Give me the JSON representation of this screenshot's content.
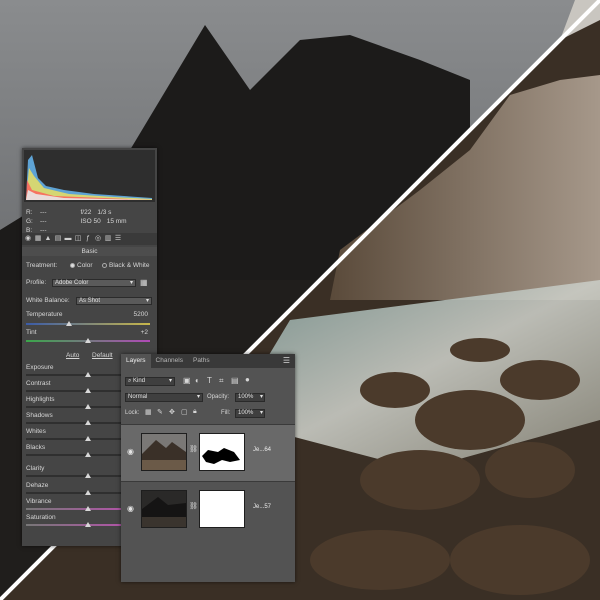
{
  "acr": {
    "readout": {
      "r": "R:",
      "g": "G:",
      "b": "B:",
      "dashes": "---",
      "aperture": "f/22",
      "shutter": "1/3 s",
      "iso": "ISO 50",
      "focal": "15 mm"
    },
    "section_title": "Basic",
    "treatment_label": "Treatment:",
    "treatment_color": "Color",
    "treatment_bw": "Black & White",
    "profile_label": "Profile:",
    "profile_value": "Adobe Color",
    "wb_label": "White Balance:",
    "wb_value": "As Shot",
    "temperature_label": "Temperature",
    "temperature_value": "5200",
    "tint_label": "Tint",
    "tint_value": "+2",
    "auto": "Auto",
    "default": "Default",
    "sliders": [
      {
        "label": "Exposure",
        "level": 0.5
      },
      {
        "label": "Contrast",
        "level": 0.5
      },
      {
        "label": "Highlights",
        "level": 0.5
      },
      {
        "label": "Shadows",
        "level": 0.5
      },
      {
        "label": "Whites",
        "level": 0.5
      },
      {
        "label": "Blacks",
        "level": 0.5
      },
      {
        "label": "Clarity",
        "level": 0.5
      },
      {
        "label": "Dehaze",
        "level": 0.5
      },
      {
        "label": "Vibrance",
        "level": 0.5
      },
      {
        "label": "Saturation",
        "level": 0.5
      }
    ],
    "temperature_level": 0.35,
    "tint_level": 0.5
  },
  "layers": {
    "tabs": [
      "Layers",
      "Channels",
      "Paths"
    ],
    "kind_label": "Kind",
    "blend_mode": "Normal",
    "opacity_label": "Opacity:",
    "opacity_value": "100%",
    "lock_label": "Lock:",
    "fill_label": "Fill:",
    "fill_value": "100%",
    "items": [
      {
        "name": "Je...64",
        "selected": true
      },
      {
        "name": "Je...57",
        "selected": false
      }
    ]
  }
}
